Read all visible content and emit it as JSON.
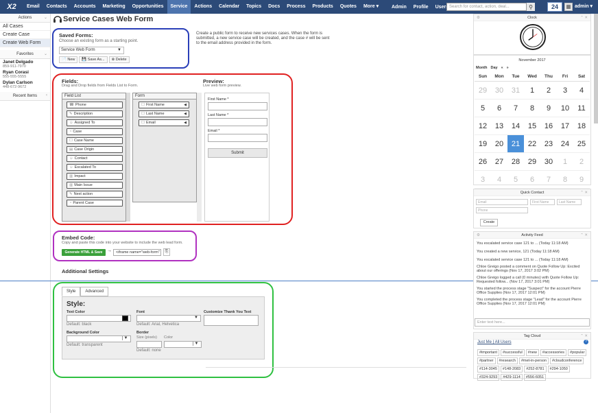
{
  "topbar": {
    "logo": "X2",
    "nav": [
      "Email",
      "Contacts",
      "Accounts",
      "Marketing",
      "Opportunities",
      "Service",
      "Actions",
      "Calendar",
      "Topics",
      "Docs",
      "Process",
      "Products",
      "Quotes",
      "More ▾"
    ],
    "active": "Service",
    "right": [
      "Admin",
      "Profile",
      "Users"
    ],
    "search_placeholder": "Search for contact, action, deal...",
    "count": "24",
    "user": "admin ▾"
  },
  "sidebar": {
    "actions_title": "Actions",
    "actions": [
      "All Cases",
      "Create Case",
      "Create Web Form"
    ],
    "favorites_title": "Favorites",
    "favorites": [
      {
        "name": "Janet Delgado",
        "phone": "859-911-7970"
      },
      {
        "name": "Ryan Corasi",
        "phone": "555-555-5555"
      },
      {
        "name": "Dylan Carlson",
        "phone": "448-672-9672"
      }
    ],
    "recent_title": "Recent Items"
  },
  "page": {
    "title": "Service Cases Web Form",
    "saved_forms_title": "Saved Forms:",
    "saved_forms_sub": "Choose an existing form as a starting point.",
    "saved_form_value": "Service Web Form",
    "buttons": [
      "New",
      "Save As...",
      "Delete"
    ],
    "intro": "Create a public form to receive new services cases. When the form is submitted, a new service case will be created, and the case # will be sent to the email address provided in the form."
  },
  "fields": {
    "title": "Fields:",
    "sub": "Drag and Drop fields from Fields List to Form.",
    "list_header": "Field List",
    "list": [
      "Phone",
      "Description",
      "Assigned To",
      "Case",
      "Case Name",
      "Case Origin",
      "Contact",
      "Escalated To",
      "Impact",
      "Main Issue",
      "Next action",
      "Parent Case"
    ],
    "form_header": "Form",
    "form": [
      "First Name",
      "Last Name",
      "Email"
    ]
  },
  "preview": {
    "title": "Preview:",
    "sub": "Live web form preview.",
    "labels": [
      "First Name *",
      "Last Name *",
      "Email *"
    ],
    "submit": "Submit"
  },
  "embed": {
    "title": "Embed Code:",
    "sub": "Copy and paste this code into your website to include the web lead form.",
    "generate": "Generate HTML & Save",
    "arrow": "→",
    "code": "<iframe name=\"web-form\""
  },
  "additional": {
    "title": "Additional Settings",
    "tabs": [
      "Style",
      "Advanced"
    ],
    "style_heading": "Style:",
    "text_color": "Text Color",
    "text_color_default": "Default: black",
    "font": "Font",
    "font_default": "Default: Arial, Helvetica",
    "thankyou": "Customize Thank You Text",
    "bg_color": "Background Color",
    "bg_default": "Default: transparent",
    "border": "Border",
    "border_size": "Size (pixels)",
    "border_color": "Color",
    "border_default": "Default: none"
  },
  "right": {
    "clock_title": "Clock",
    "month": "November 2017",
    "calnav": [
      "Month",
      "Day",
      "«",
      "»"
    ],
    "days": [
      "Sun",
      "Mon",
      "Tue",
      "Wed",
      "Thu",
      "Fri",
      "Sat"
    ],
    "dates": [
      [
        "29",
        "30",
        "31",
        "1",
        "2",
        "3",
        "4"
      ],
      [
        "5",
        "6",
        "7",
        "8",
        "9",
        "10",
        "11"
      ],
      [
        "12",
        "13",
        "14",
        "15",
        "16",
        "17",
        "18"
      ],
      [
        "19",
        "20",
        "21",
        "22",
        "23",
        "24",
        "25"
      ],
      [
        "26",
        "27",
        "28",
        "29",
        "30",
        "1",
        "2"
      ],
      [
        "3",
        "4",
        "5",
        "6",
        "7",
        "8",
        "9"
      ]
    ],
    "today": "21",
    "quick_contact_title": "Quick Contact",
    "qc_email": "Email",
    "qc_first": "First Name",
    "qc_last": "Last Name",
    "qc_phone": "Phone",
    "qc_create": "Create",
    "activity_title": "Activity Feed",
    "activity": [
      "You escalated service case 121 to ... (Today 11:18 AM)",
      "You created a new service, 121 (Today 11:18 AM)",
      "You escalated service case 121 to ... (Today 11:18 AM)",
      "Chloe Greigo posted a comment on Quote Follow Up: Excited about our offerings (Nov 17, 2017 3:02 PM)",
      "Chloe Greigo logged a call (0 minutes) with Quote Follow Up: Requested follow... (Nov 17, 2017 3:01 PM)",
      "You started the process stage \"Suspect\" for the account Pierre Office Supplies (Nov 17, 2017 12:01 PM)",
      "You completed the process stage \"Lead\" for the account Pierre Office Supplies (Nov 17, 2017 12:01 PM)"
    ],
    "enter_text": "Enter text here...",
    "tag_title": "Tag Cloud",
    "tag_links": "Just Me | All Users",
    "tags": [
      "#important",
      "#successful",
      "#new",
      "#accessories",
      "#popular",
      "#partner",
      "#research",
      "#met-in-person",
      "#cloudconference",
      "#114-3045",
      "#148-2083",
      "#252-8781",
      "#294-1050",
      "#324-9293",
      "#429-1114",
      "#556-6051"
    ]
  }
}
